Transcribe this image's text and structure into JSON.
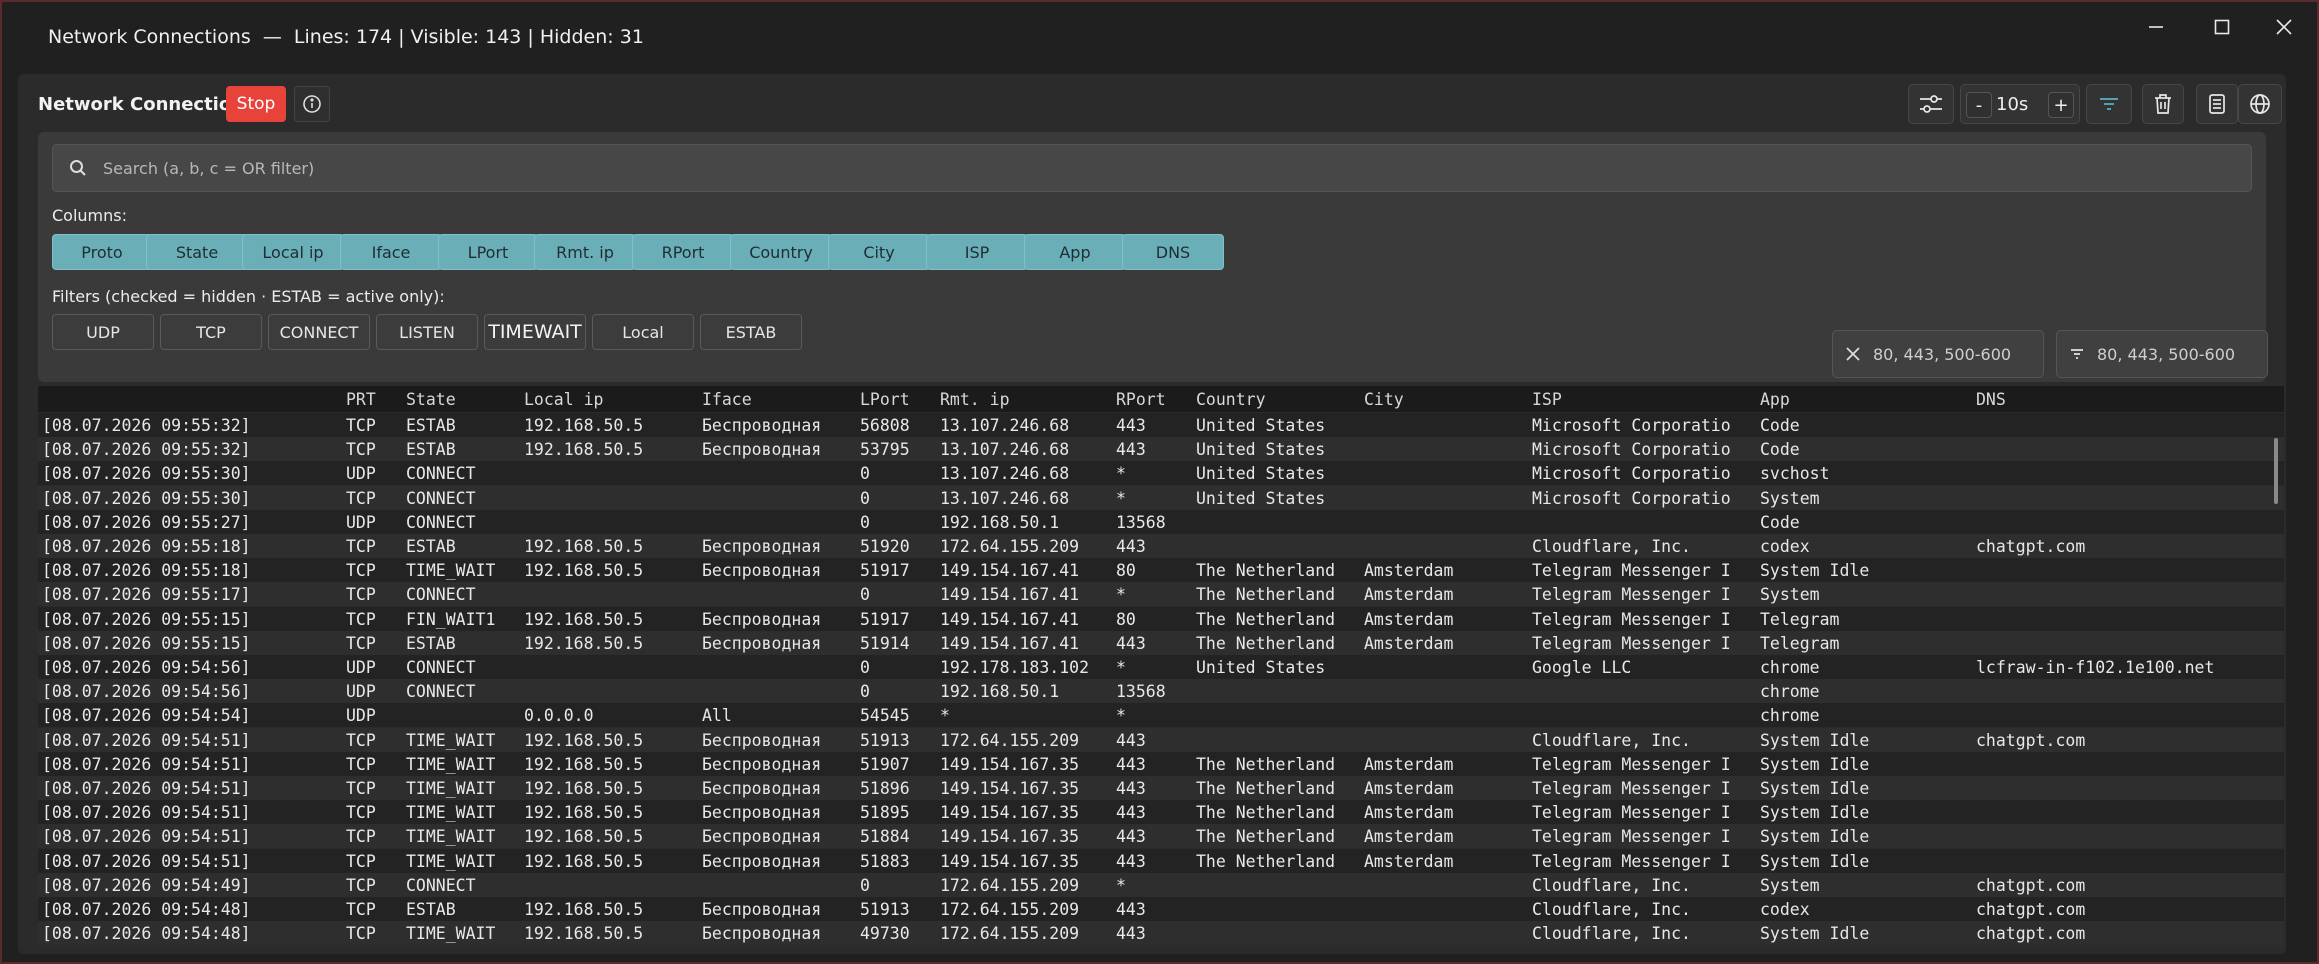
{
  "window": {
    "title": "Network Connections  —  Lines: 174 | Visible: 143 | Hidden: 31"
  },
  "toolbar": {
    "title": "Network Connections",
    "stop_label": "Stop",
    "minus_label": "-",
    "interval": "10s",
    "plus_label": "+"
  },
  "search": {
    "placeholder": "Search (a, b, c = OR filter)",
    "value": ""
  },
  "columns_label": "Columns:",
  "column_chips": [
    "Proto",
    "State",
    "Local ip",
    "Iface",
    "LPort",
    "Rmt. ip",
    "RPort",
    "Country",
    "City",
    "ISP",
    "App",
    "DNS"
  ],
  "filters_label": "Filters (checked = hidden · ESTAB = active only):",
  "filter_chips": [
    "UDP",
    "TCP",
    "CONNECT",
    "LISTEN",
    "TIMEWAIT",
    "Local",
    "ESTAB"
  ],
  "port_exclude": {
    "placeholder": "80, 443, 500-600"
  },
  "port_include": {
    "placeholder": "80, 443, 500-600"
  },
  "table": {
    "headers": [
      "",
      "PRT",
      "State",
      "Local ip",
      "Iface",
      "LPort",
      "Rmt. ip",
      "RPort",
      "Country",
      "City",
      "ISP",
      "App",
      "DNS"
    ],
    "rows": [
      [
        "[08.07.2026 09:55:32]",
        "TCP",
        "ESTAB",
        "192.168.50.5",
        "Беспроводная",
        "56808",
        "13.107.246.68",
        "443",
        "United States",
        "",
        "Microsoft Corporatio",
        "Code",
        ""
      ],
      [
        "[08.07.2026 09:55:32]",
        "TCP",
        "ESTAB",
        "192.168.50.5",
        "Беспроводная",
        "53795",
        "13.107.246.68",
        "443",
        "United States",
        "",
        "Microsoft Corporatio",
        "Code",
        ""
      ],
      [
        "[08.07.2026 09:55:30]",
        "UDP",
        "CONNECT",
        "",
        "",
        "0",
        "13.107.246.68",
        "*",
        "United States",
        "",
        "Microsoft Corporatio",
        "svchost",
        ""
      ],
      [
        "[08.07.2026 09:55:30]",
        "TCP",
        "CONNECT",
        "",
        "",
        "0",
        "13.107.246.68",
        "*",
        "United States",
        "",
        "Microsoft Corporatio",
        "System",
        ""
      ],
      [
        "[08.07.2026 09:55:27]",
        "UDP",
        "CONNECT",
        "",
        "",
        "0",
        "192.168.50.1",
        "13568",
        "",
        "",
        "",
        "Code",
        ""
      ],
      [
        "[08.07.2026 09:55:18]",
        "TCP",
        "ESTAB",
        "192.168.50.5",
        "Беспроводная",
        "51920",
        "172.64.155.209",
        "443",
        "",
        "",
        "Cloudflare, Inc.",
        "codex",
        "chatgpt.com"
      ],
      [
        "[08.07.2026 09:55:18]",
        "TCP",
        "TIME_WAIT",
        "192.168.50.5",
        "Беспроводная",
        "51917",
        "149.154.167.41",
        "80",
        "The Netherland",
        "Amsterdam",
        "Telegram Messenger I",
        "System Idle",
        ""
      ],
      [
        "[08.07.2026 09:55:17]",
        "TCP",
        "CONNECT",
        "",
        "",
        "0",
        "149.154.167.41",
        "*",
        "The Netherland",
        "Amsterdam",
        "Telegram Messenger I",
        "System",
        ""
      ],
      [
        "[08.07.2026 09:55:15]",
        "TCP",
        "FIN_WAIT1",
        "192.168.50.5",
        "Беспроводная",
        "51917",
        "149.154.167.41",
        "80",
        "The Netherland",
        "Amsterdam",
        "Telegram Messenger I",
        "Telegram",
        ""
      ],
      [
        "[08.07.2026 09:55:15]",
        "TCP",
        "ESTAB",
        "192.168.50.5",
        "Беспроводная",
        "51914",
        "149.154.167.41",
        "443",
        "The Netherland",
        "Amsterdam",
        "Telegram Messenger I",
        "Telegram",
        ""
      ],
      [
        "[08.07.2026 09:54:56]",
        "UDP",
        "CONNECT",
        "",
        "",
        "0",
        "192.178.183.102",
        "*",
        "United States",
        "",
        "Google LLC",
        "chrome",
        "lcfraw-in-f102.1e100.net"
      ],
      [
        "[08.07.2026 09:54:56]",
        "UDP",
        "CONNECT",
        "",
        "",
        "0",
        "192.168.50.1",
        "13568",
        "",
        "",
        "",
        "chrome",
        ""
      ],
      [
        "[08.07.2026 09:54:54]",
        "UDP",
        "",
        "0.0.0.0",
        "All",
        "54545",
        "*",
        "*",
        "",
        "",
        "",
        "chrome",
        ""
      ],
      [
        "[08.07.2026 09:54:51]",
        "TCP",
        "TIME_WAIT",
        "192.168.50.5",
        "Беспроводная",
        "51913",
        "172.64.155.209",
        "443",
        "",
        "",
        "Cloudflare, Inc.",
        "System Idle",
        "chatgpt.com"
      ],
      [
        "[08.07.2026 09:54:51]",
        "TCP",
        "TIME_WAIT",
        "192.168.50.5",
        "Беспроводная",
        "51907",
        "149.154.167.35",
        "443",
        "The Netherland",
        "Amsterdam",
        "Telegram Messenger I",
        "System Idle",
        ""
      ],
      [
        "[08.07.2026 09:54:51]",
        "TCP",
        "TIME_WAIT",
        "192.168.50.5",
        "Беспроводная",
        "51896",
        "149.154.167.35",
        "443",
        "The Netherland",
        "Amsterdam",
        "Telegram Messenger I",
        "System Idle",
        ""
      ],
      [
        "[08.07.2026 09:54:51]",
        "TCP",
        "TIME_WAIT",
        "192.168.50.5",
        "Беспроводная",
        "51895",
        "149.154.167.35",
        "443",
        "The Netherland",
        "Amsterdam",
        "Telegram Messenger I",
        "System Idle",
        ""
      ],
      [
        "[08.07.2026 09:54:51]",
        "TCP",
        "TIME_WAIT",
        "192.168.50.5",
        "Беспроводная",
        "51884",
        "149.154.167.35",
        "443",
        "The Netherland",
        "Amsterdam",
        "Telegram Messenger I",
        "System Idle",
        ""
      ],
      [
        "[08.07.2026 09:54:51]",
        "TCP",
        "TIME_WAIT",
        "192.168.50.5",
        "Беспроводная",
        "51883",
        "149.154.167.35",
        "443",
        "The Netherland",
        "Amsterdam",
        "Telegram Messenger I",
        "System Idle",
        ""
      ],
      [
        "[08.07.2026 09:54:49]",
        "TCP",
        "CONNECT",
        "",
        "",
        "0",
        "172.64.155.209",
        "*",
        "",
        "",
        "Cloudflare, Inc.",
        "System",
        "chatgpt.com"
      ],
      [
        "[08.07.2026 09:54:48]",
        "TCP",
        "ESTAB",
        "192.168.50.5",
        "Беспроводная",
        "51913",
        "172.64.155.209",
        "443",
        "",
        "",
        "Cloudflare, Inc.",
        "codex",
        "chatgpt.com"
      ],
      [
        "[08.07.2026 09:54:48]",
        "TCP",
        "TIME_WAIT",
        "192.168.50.5",
        "Беспроводная",
        "49730",
        "172.64.155.209",
        "443",
        "",
        "",
        "Cloudflare, Inc.",
        "System Idle",
        "chatgpt.com"
      ]
    ]
  }
}
